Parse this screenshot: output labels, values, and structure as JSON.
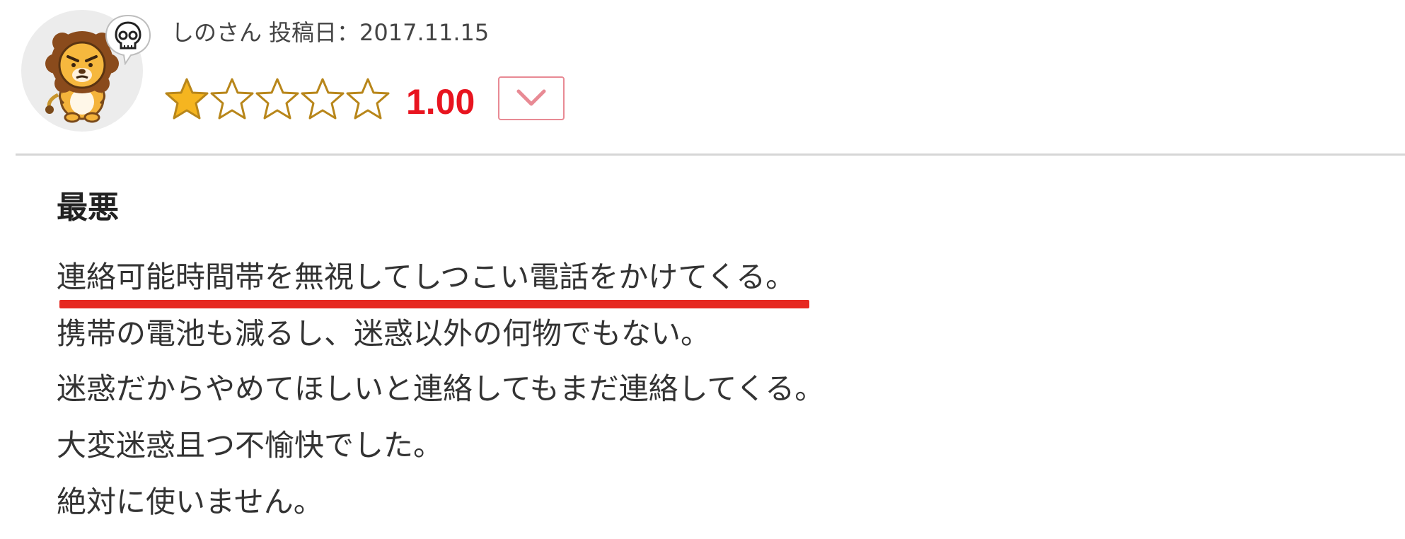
{
  "review": {
    "reviewer_name": "しのさん",
    "post_date_label": "投稿日：2017.11.15",
    "avatar": {
      "icon": "lion-avatar-icon",
      "badge_icon": "skull-icon"
    },
    "rating": {
      "value": 1,
      "max": 5,
      "score_text": "1.00",
      "star_color": "#f5b520",
      "score_color": "#e8141f"
    },
    "toggle_icon": "chevron-down-icon",
    "title": "最悪",
    "body_lines": [
      "連絡可能時間帯を無視してしつこい電話をかけてくる。",
      "携帯の電池も減るし、迷惑以外の何物でもない。",
      "迷惑だからやめてほしいと連絡してもまだ連絡してくる。",
      "大変迷惑且つ不愉快でした。",
      "絶対に使いません。"
    ],
    "highlight_color": "#e62820"
  }
}
